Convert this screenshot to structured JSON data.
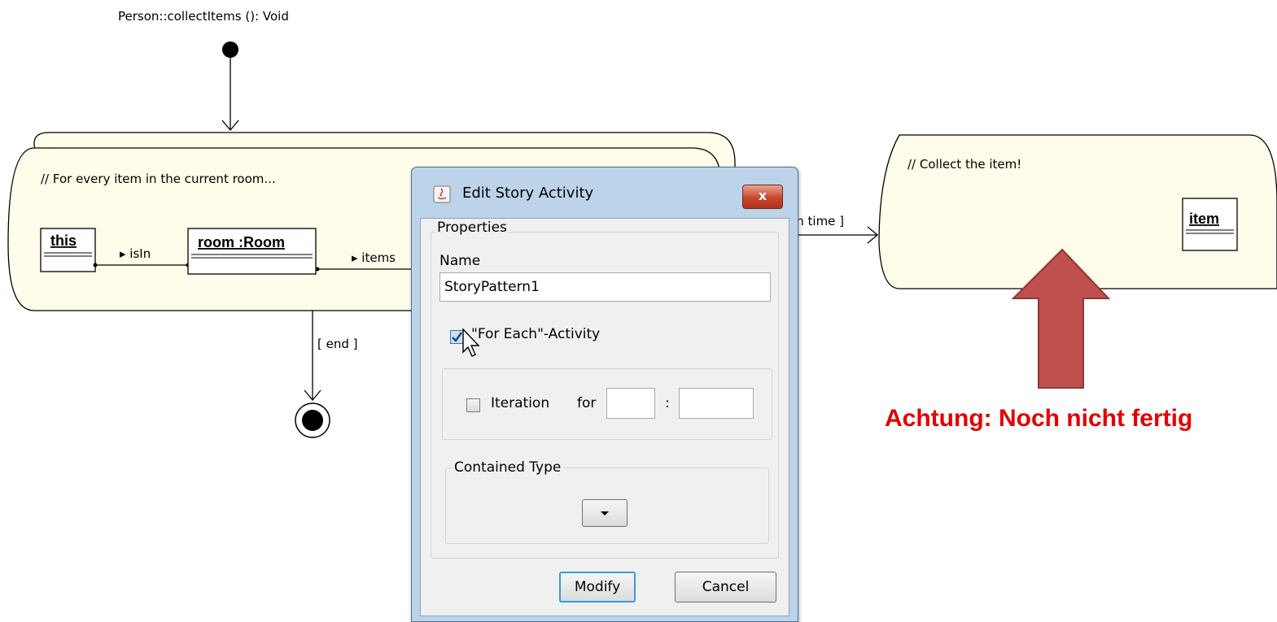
{
  "diagram": {
    "method_signature": "Person::collectItems (): Void",
    "activity1": {
      "comment": "// For every item in the current room...",
      "obj_this": "this",
      "link_isin": "▸ isIn",
      "obj_room": "room :Room",
      "link_items": "▸ items"
    },
    "transition_each_time": "ch time ]",
    "transition_end": "[ end ]",
    "activity2": {
      "comment": "// Collect the item!",
      "obj_item": "item"
    },
    "warning": "Achtung: Noch nicht fertig",
    "colors": {
      "activity_fill": "#fffde9",
      "arrow": "#c0504d",
      "warning": "#e30000"
    }
  },
  "dialog": {
    "title": "Edit Story Activity",
    "close_label": "x",
    "properties_legend": "Properties",
    "name_label": "Name",
    "name_value": "StoryPattern1",
    "for_each_label": "\"For Each\"-Activity",
    "for_each_checked": true,
    "iteration_label": "Iteration",
    "for_label": "for",
    "colon": ":",
    "contained_type_legend": "Contained Type",
    "modify_label": "Modify",
    "cancel_label": "Cancel"
  }
}
